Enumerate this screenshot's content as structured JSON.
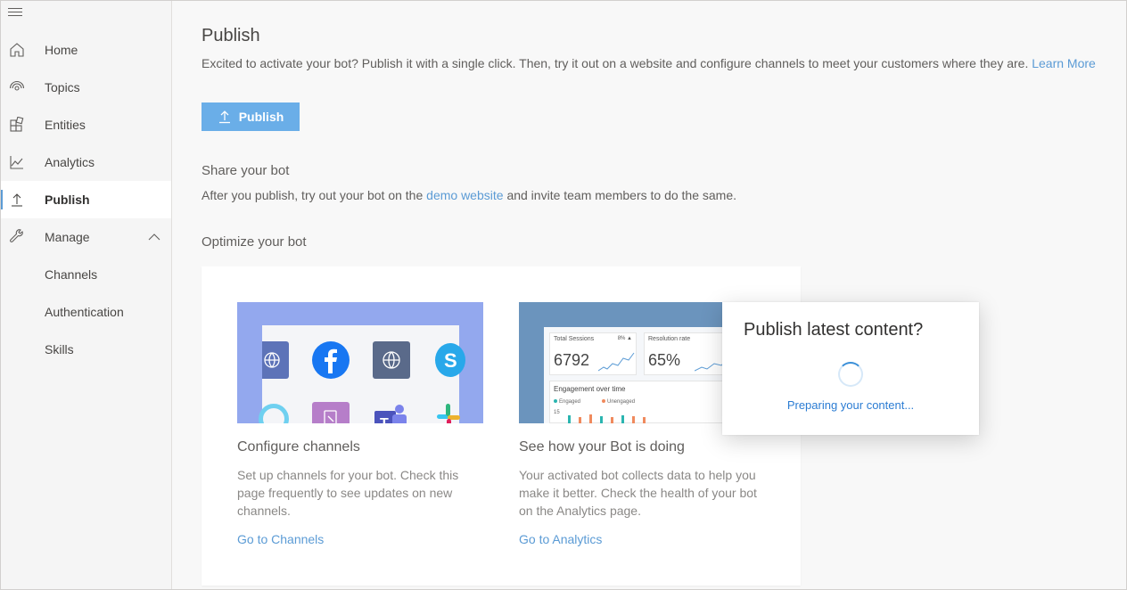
{
  "sidebar": {
    "items": [
      {
        "label": "Home",
        "icon": "home-icon"
      },
      {
        "label": "Topics",
        "icon": "topics-icon"
      },
      {
        "label": "Entities",
        "icon": "entities-icon"
      },
      {
        "label": "Analytics",
        "icon": "analytics-icon"
      },
      {
        "label": "Publish",
        "icon": "publish-icon",
        "active": true
      },
      {
        "label": "Manage",
        "icon": "wrench-icon",
        "expanded": true
      }
    ],
    "sub_items": [
      {
        "label": "Channels"
      },
      {
        "label": "Authentication"
      },
      {
        "label": "Skills"
      }
    ]
  },
  "main": {
    "title": "Publish",
    "intro_text": "Excited to activate your bot? Publish it with a single click. Then, try it out on a website and configure channels to meet your customers where they are.",
    "intro_link": "Learn More",
    "publish_button": "Publish",
    "share_title": "Share your bot",
    "share_text_before": "After you publish, try out your bot on the",
    "share_link": "demo website",
    "share_text_after": "and invite team members to do the same.",
    "optimize_title": "Optimize your bot",
    "cards": [
      {
        "title": "Configure channels",
        "text": "Set up channels for your bot. Check this page frequently to see updates on new channels.",
        "link": "Go to Channels"
      },
      {
        "title": "See how your Bot is doing",
        "text": "Your activated bot collects data to help you make it better. Check the health of your bot on the Analytics page.",
        "link": "Go to Analytics"
      }
    ],
    "analytics_thumb": {
      "total_sessions_label": "Total Sessions",
      "total_sessions_value": "6792",
      "total_sessions_delta": "8% ▲",
      "resolution_label": "Resolution rate",
      "resolution_value": "65%",
      "engagement_label": "Engagement over time",
      "legend_engaged": "Engaged",
      "legend_unengaged": "Unengaged",
      "axis_tick": "15"
    }
  },
  "dialog": {
    "title": "Publish latest content?",
    "status": "Preparing your content..."
  },
  "colors": {
    "accent": "#5b9bd5",
    "button": "#6aaee8",
    "channels_bg": "#93a8ee",
    "analytics_bg": "#6b94bd"
  }
}
